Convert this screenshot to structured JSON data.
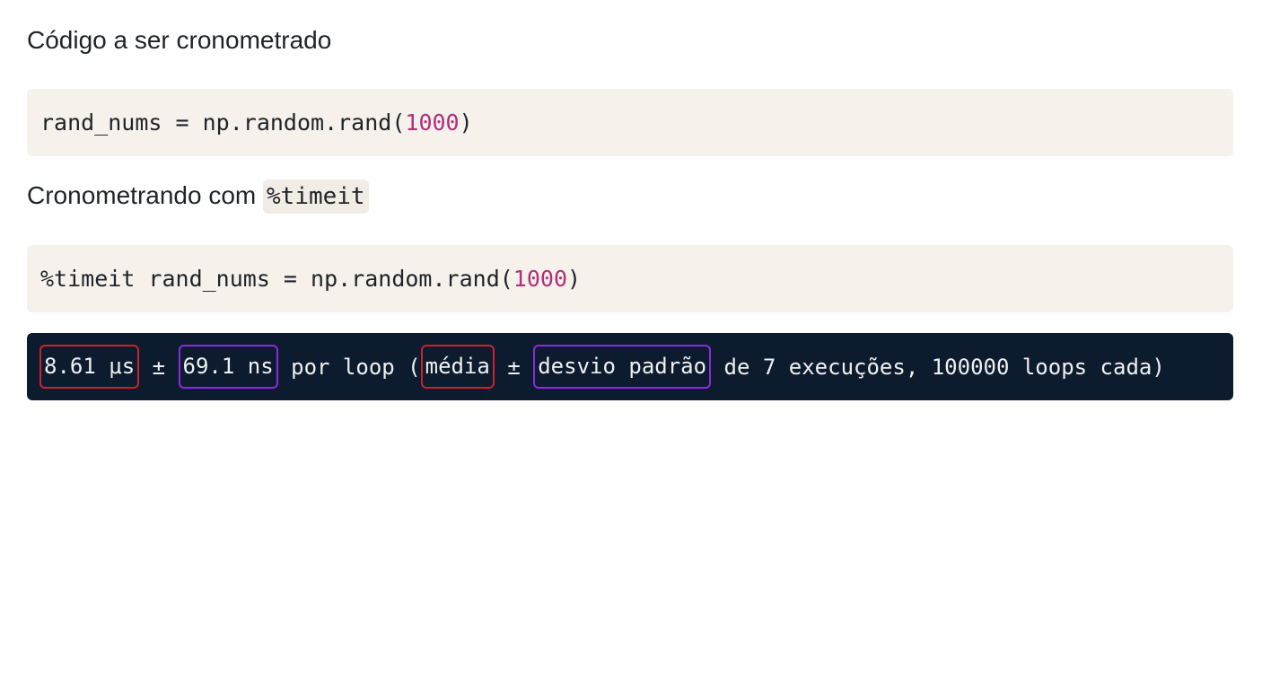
{
  "section1": {
    "heading": "Código a ser cronometrado"
  },
  "code1": {
    "before": "rand_nums = np.random.rand(",
    "number": "1000",
    "after": ")"
  },
  "section2": {
    "heading_text": "Cronometrando com ",
    "inline_code": "%timeit"
  },
  "code2": {
    "before": "%timeit rand_nums = np.random.rand(",
    "number": "1000",
    "after": ")"
  },
  "output": {
    "mean_value": "8.61 μs",
    "plus_minus_1": " ± ",
    "std_value": "69.1 ns",
    "mid_text": " por loop (",
    "mean_label": "média",
    "plus_minus_2": " ± ",
    "std_label": "desvio padrão",
    "tail_text": " de 7 execuções, 100000 loops cada)"
  },
  "colors": {
    "code_bg": "#f6f1eb",
    "output_bg": "#0d1b2e",
    "number": "#b0307a",
    "highlight_red": "#c8232c",
    "highlight_purple": "#8a2be2"
  }
}
